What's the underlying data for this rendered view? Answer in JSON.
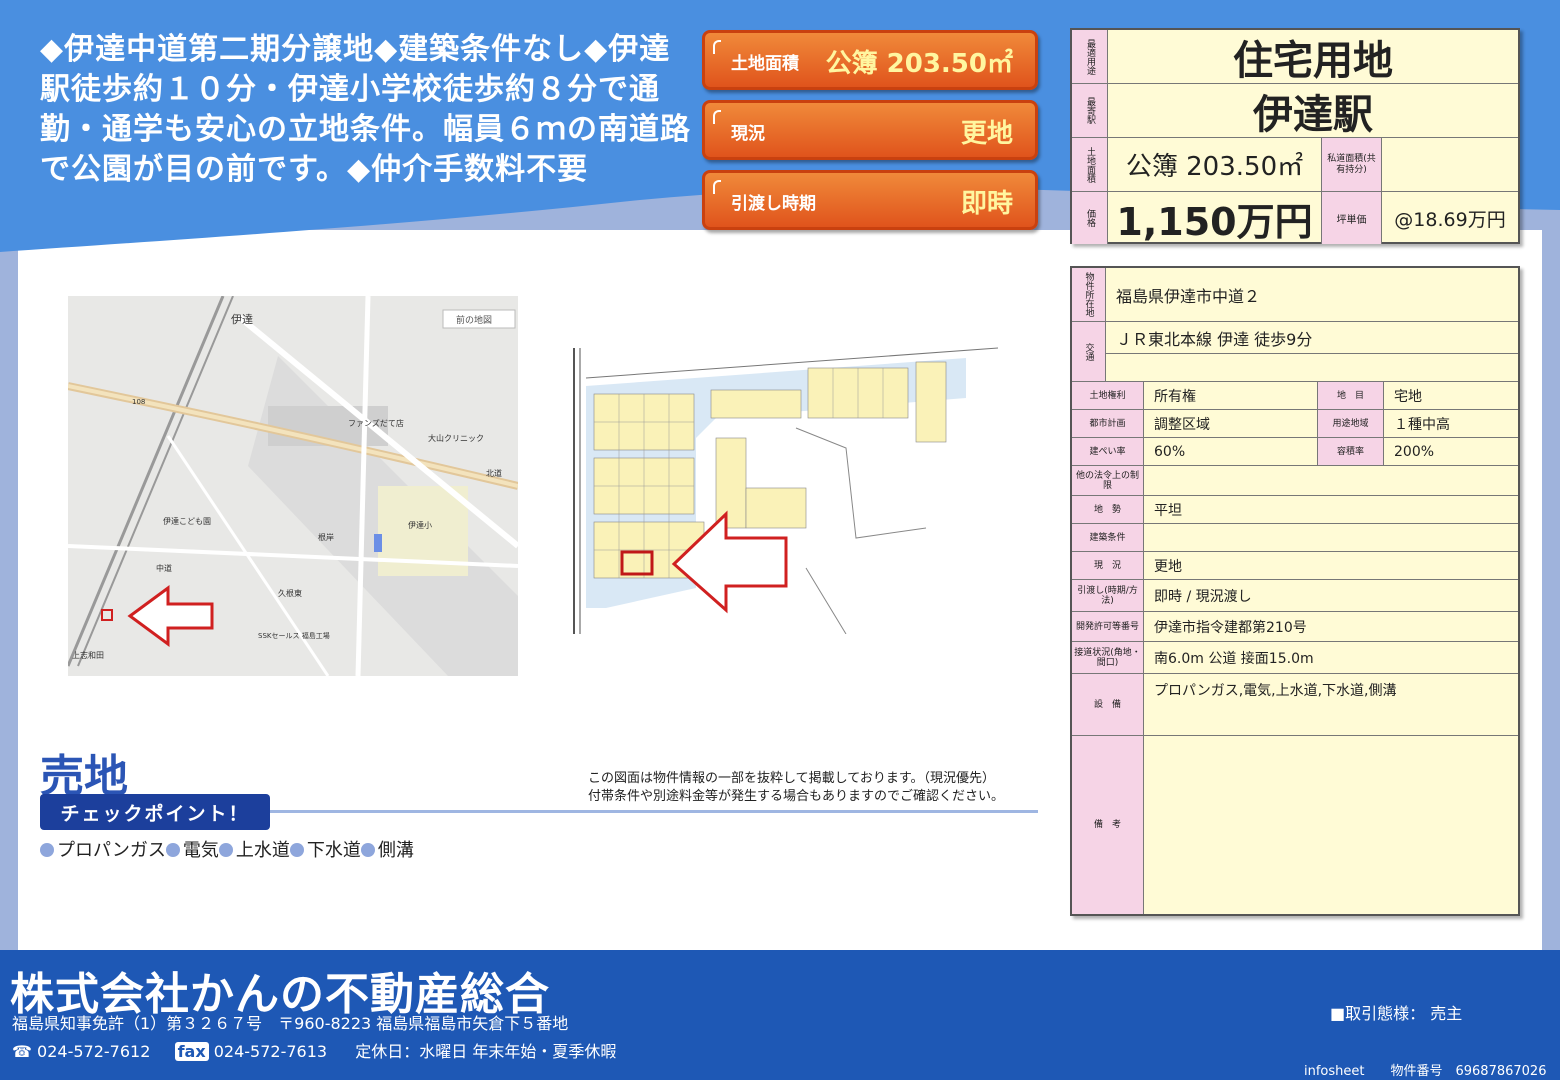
{
  "headline": "◆伊達中道第二期分譲地◆建築条件なし◆伊達駅徒歩約１０分・伊達小学校徒歩約８分で通勤・通学も安心の立地条件。幅員６ｍの南道路で公園が目の前です。◆仲介手数料不要",
  "badges": [
    {
      "label": "土地面積",
      "value": "公簿 203.50㎡"
    },
    {
      "label": "現況",
      "value": "更地"
    },
    {
      "label": "引渡し時期",
      "value": "即時"
    }
  ],
  "top_table": {
    "use_label": "最適用途",
    "use_value": "住宅用地",
    "station_label": "最寄駅",
    "station_value": "伊達駅",
    "area_label": "土地面積",
    "area_value": "公簿 203.50㎡",
    "private_road_label": "私道面積(共有持分)",
    "private_road_value": "",
    "price_label": "価格",
    "price_value": "1,150万円",
    "tsubo_label": "坪単価",
    "tsubo_value": "@18.69万円"
  },
  "details": {
    "location_label": "物件所在地",
    "location_value": "福島県伊達市中道２",
    "transport_label": "交通",
    "transport_value": "ＪＲ東北本線 伊達 徒歩9分",
    "rights_label": "土地権利",
    "rights_value": "所有権",
    "chimoku_label": "地　目",
    "chimoku_value": "宅地",
    "city_plan_label": "都市計画",
    "city_plan_value": "調整区域",
    "zoning_label": "用途地域",
    "zoning_value": "１種中高",
    "bcr_label": "建ぺい率",
    "bcr_value": "60%",
    "far_label": "容積率",
    "far_value": "200%",
    "other_law_label": "他の法令上の制限",
    "other_law_value": "",
    "terrain_label": "地　勢",
    "terrain_value": "平坦",
    "build_cond_label": "建築条件",
    "build_cond_value": "",
    "status_label": "現　況",
    "status_value": "更地",
    "handover_label": "引渡し(時期/方法)",
    "handover_value": "即時 / 現況渡し",
    "permit_label": "開発許可等番号",
    "permit_value": "伊達市指令建都第210号",
    "road_label": "接道状況(角地・間口)",
    "road_value": "南6.0m 公道 接面15.0m",
    "facility_label": "設　備",
    "facility_value": "プロパンガス,電気,上水道,下水道,側溝",
    "remarks_label": "備　考",
    "remarks_value": ""
  },
  "map_labels": {
    "station": "伊達",
    "north_label": "北道",
    "store": "ファンズだて店",
    "clinic": "大山クリニック",
    "school": "伊達小",
    "nursery": "伊達こども園",
    "area1": "中道",
    "area2": "久根東",
    "area3": "上志和田",
    "area4": "根岸",
    "route": "108",
    "back": "前の地図",
    "factory": "SSKセールス 福島工場"
  },
  "sale_title": "売地",
  "check_title": "チェックポイント！",
  "check_items": [
    "プロパンガス",
    "電気",
    "上水道",
    "下水道",
    "側溝"
  ],
  "note_lines": [
    "この図面は物件情報の一部を抜粋して掲載しております。（現況優先）",
    "付帯条件や別途料金等が発生する場合もありますのでご確認ください。"
  ],
  "footer": {
    "company": "株式会社かんの不動産総合",
    "license": "福島県知事免許（1）第３２６７号　〒960-8223 福島県福島市矢倉下５番地",
    "tel": "024-572-7612",
    "fax_label": "fax",
    "fax": "024-572-7613",
    "holiday": "定休日：水曜日 年末年始・夏季休暇",
    "deal": "■取引態様：  売主",
    "infosheet": "infosheet　　物件番号　69687867026"
  },
  "colors": {
    "header_blue": "#4a8fe0",
    "badge_orange": "#e8651f",
    "table_yellow": "#fffbd6",
    "label_pink": "#f6d4e6",
    "footer_blue": "#1e58b5"
  }
}
